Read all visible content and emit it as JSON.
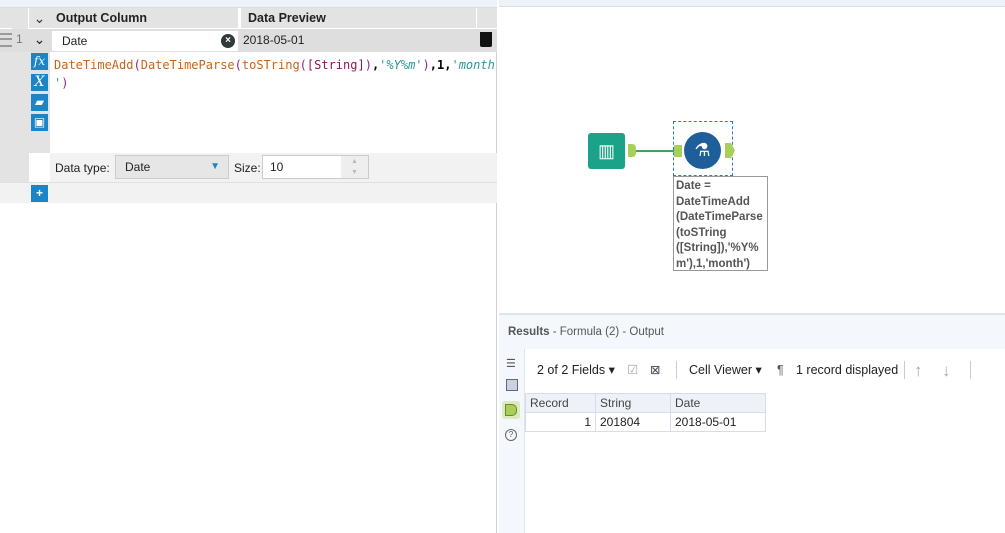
{
  "formula_panel": {
    "headers": {
      "output_column": "Output Column",
      "data_preview": "Data Preview"
    },
    "row": {
      "number": "1",
      "output_column": "Date",
      "preview": "2018-05-01"
    },
    "expression": {
      "line1_parts": [
        {
          "t": "DateTimeAdd",
          "k": "fn"
        },
        {
          "t": "(",
          "k": "par"
        },
        {
          "t": "DateTimeParse",
          "k": "fn"
        },
        {
          "t": "(",
          "k": "par"
        },
        {
          "t": "toSTring",
          "k": "fn"
        },
        {
          "t": "(",
          "k": "par"
        },
        {
          "t": "[String]",
          "k": "fld"
        },
        {
          "t": ")",
          "k": "par"
        },
        {
          "t": ",",
          "k": "num"
        },
        {
          "t": "'%Y%m'",
          "k": "str"
        },
        {
          "t": ")",
          "k": "par"
        },
        {
          "t": ",",
          "k": "num"
        },
        {
          "t": "1",
          "k": "num"
        },
        {
          "t": ",",
          "k": "num"
        },
        {
          "t": "'month",
          "k": "str"
        }
      ],
      "line2_parts": [
        {
          "t": "'",
          "k": "str"
        },
        {
          "t": ")",
          "k": "par"
        }
      ]
    },
    "icons": [
      "fx-icon",
      "variable-x-icon",
      "open-folder-icon",
      "save-icon"
    ],
    "data_type_label": "Data type:",
    "data_type_value": "Date",
    "size_label": "Size:",
    "size_value": "10"
  },
  "canvas": {
    "annotation": "Date = DateTimeAdd (DateTimeParse (toSTring ([String]),'%Y% m'),1,'month')",
    "colors": {
      "input_tool": "#1aa389",
      "formula_tool": "#1e5f99",
      "connector": "#a8cf5a"
    }
  },
  "results": {
    "title": "Results",
    "subtitle": " - Formula (2) - Output",
    "fields": "2 of 2 Fields",
    "cell_viewer": "Cell Viewer",
    "records": "1 record displayed",
    "columns": [
      "Record",
      "String",
      "Date"
    ],
    "rows": [
      [
        "1",
        "201804",
        "2018-05-01"
      ]
    ]
  }
}
